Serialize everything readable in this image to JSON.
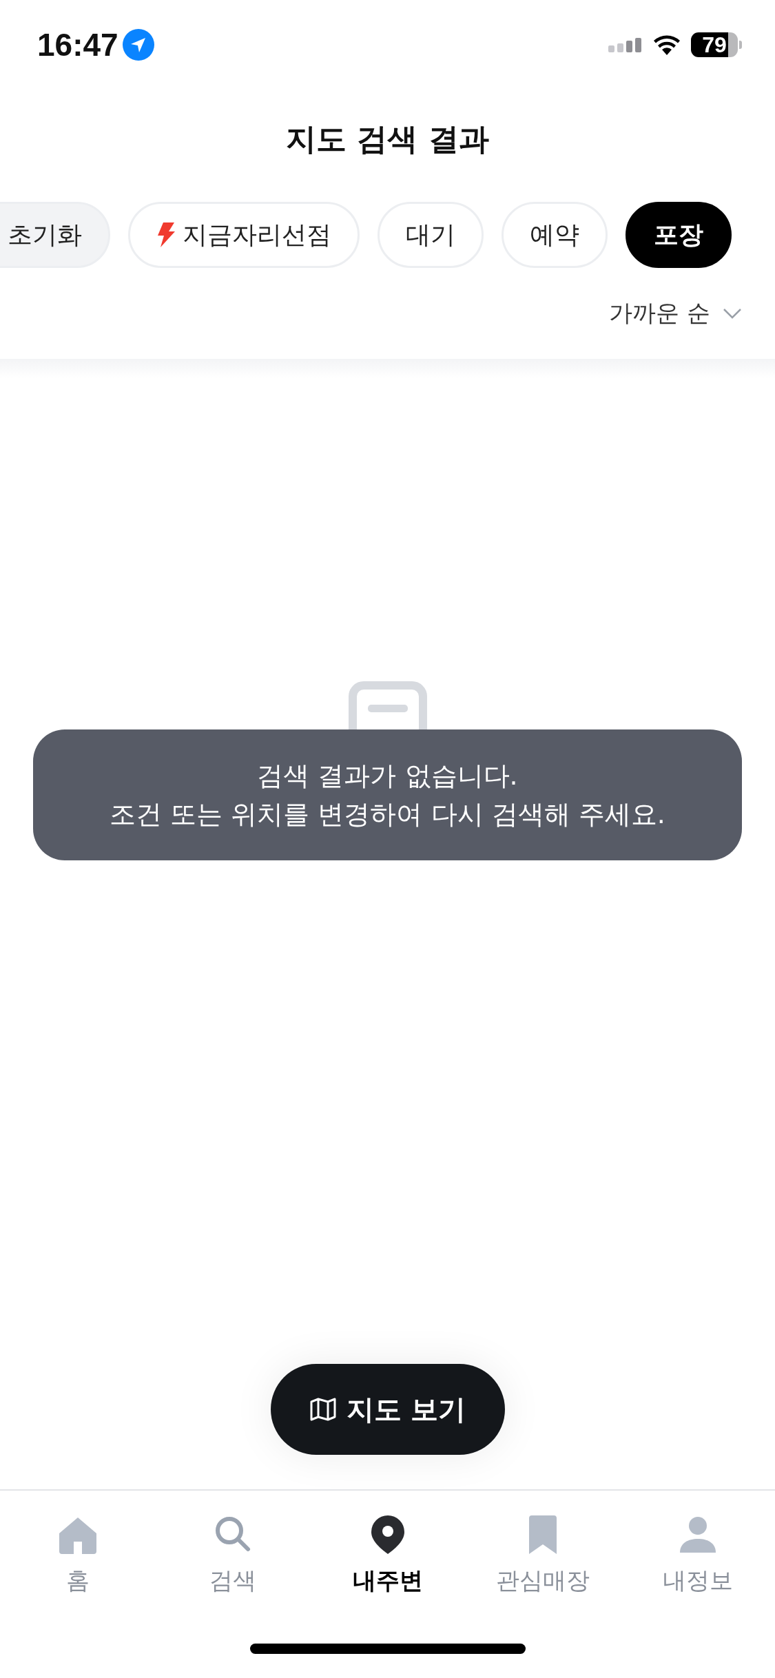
{
  "status_bar": {
    "time": "16:47",
    "battery": "79"
  },
  "header": {
    "title": "지도 검색 결과"
  },
  "filters": [
    {
      "label": "초기화",
      "kind": "reset",
      "selected": false
    },
    {
      "label": "지금자리선점",
      "kind": "flash",
      "selected": false
    },
    {
      "label": "대기",
      "kind": "plain",
      "selected": false
    },
    {
      "label": "예약",
      "kind": "plain",
      "selected": false
    },
    {
      "label": "포장",
      "kind": "plain",
      "selected": true
    }
  ],
  "sort": {
    "label": "가까운 순"
  },
  "toast": {
    "lines": [
      "검색 결과가 없습니다.",
      "조건 또는 위치를 변경하여 다시 검색해 주세요."
    ]
  },
  "map_button": {
    "label": "지도 보기"
  },
  "tab_bar": [
    {
      "label": "홈",
      "kind": "home",
      "selected": false
    },
    {
      "label": "검색",
      "kind": "search",
      "selected": false
    },
    {
      "label": "내주변",
      "kind": "pin",
      "selected": true
    },
    {
      "label": "관심매장",
      "kind": "bookmark",
      "selected": false
    },
    {
      "label": "내정보",
      "kind": "person",
      "selected": false
    }
  ]
}
